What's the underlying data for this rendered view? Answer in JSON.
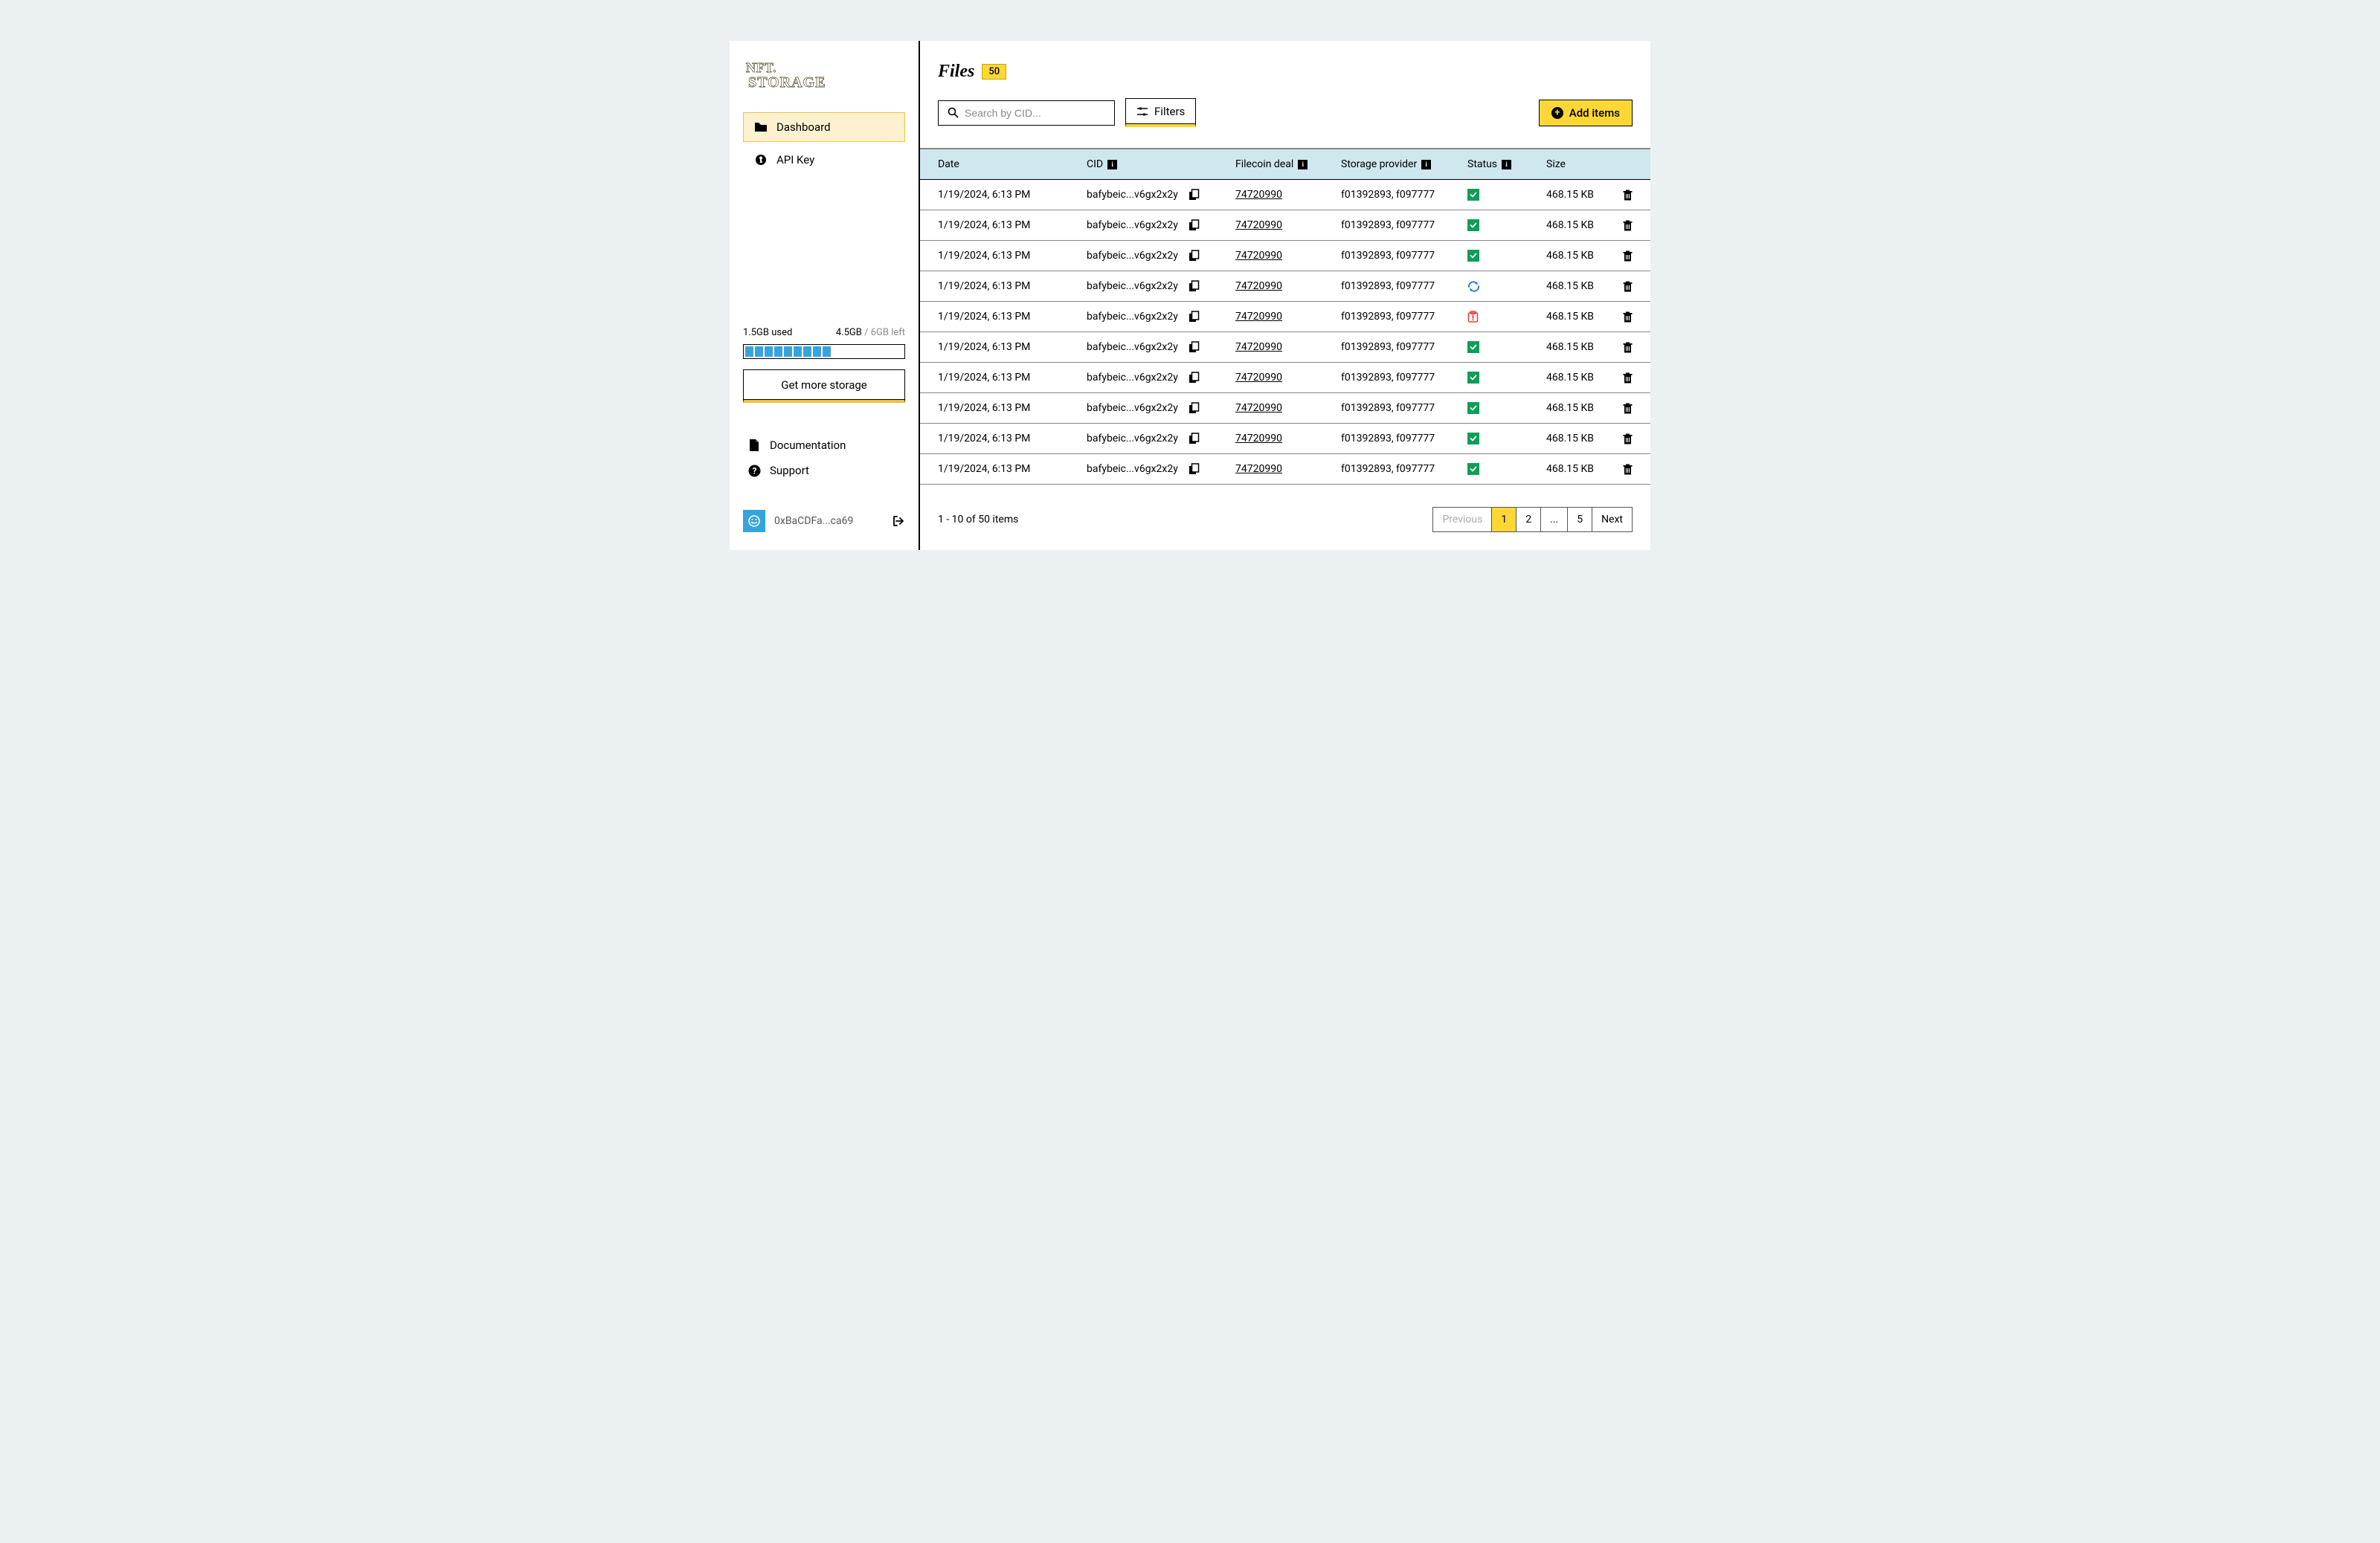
{
  "sidebar": {
    "nav": [
      {
        "label": "Dashboard",
        "icon": "folder",
        "active": true
      },
      {
        "label": "API Key",
        "icon": "key",
        "active": false
      }
    ],
    "storage": {
      "used": "1.5GB used",
      "avail": "4.5GB",
      "total_suffix": " / 6GB left",
      "segments": 9,
      "button": "Get more storage"
    },
    "util": [
      {
        "label": "Documentation",
        "icon": "doc"
      },
      {
        "label": "Support",
        "icon": "help"
      }
    ],
    "wallet": "0xBaCDFa...ca69"
  },
  "header": {
    "title": "Files",
    "count": "50",
    "search_placeholder": "Search by CID...",
    "filters": "Filters",
    "add": "Add items"
  },
  "columns": {
    "date": "Date",
    "cid": "CID",
    "deal": "Filecoin deal",
    "provider": "Storage provider",
    "status": "Status",
    "size": "Size"
  },
  "rows": [
    {
      "date": "1/19/2024, 6:13 PM",
      "cid": "bafybeic...v6gx2x2y",
      "deal": "74720990",
      "provider": "f01392893, f097777",
      "status": "ok",
      "size": "468.15 KB"
    },
    {
      "date": "1/19/2024, 6:13 PM",
      "cid": "bafybeic...v6gx2x2y",
      "deal": "74720990",
      "provider": "f01392893, f097777",
      "status": "ok",
      "size": "468.15 KB"
    },
    {
      "date": "1/19/2024, 6:13 PM",
      "cid": "bafybeic...v6gx2x2y",
      "deal": "74720990",
      "provider": "f01392893, f097777",
      "status": "ok",
      "size": "468.15 KB"
    },
    {
      "date": "1/19/2024, 6:13 PM",
      "cid": "bafybeic...v6gx2x2y",
      "deal": "74720990",
      "provider": "f01392893, f097777",
      "status": "sync",
      "size": "468.15 KB"
    },
    {
      "date": "1/19/2024, 6:13 PM",
      "cid": "bafybeic...v6gx2x2y",
      "deal": "74720990",
      "provider": "f01392893, f097777",
      "status": "err",
      "size": "468.15 KB"
    },
    {
      "date": "1/19/2024, 6:13 PM",
      "cid": "bafybeic...v6gx2x2y",
      "deal": "74720990",
      "provider": "f01392893, f097777",
      "status": "ok",
      "size": "468.15 KB"
    },
    {
      "date": "1/19/2024, 6:13 PM",
      "cid": "bafybeic...v6gx2x2y",
      "deal": "74720990",
      "provider": "f01392893, f097777",
      "status": "ok",
      "size": "468.15 KB"
    },
    {
      "date": "1/19/2024, 6:13 PM",
      "cid": "bafybeic...v6gx2x2y",
      "deal": "74720990",
      "provider": "f01392893, f097777",
      "status": "ok",
      "size": "468.15 KB"
    },
    {
      "date": "1/19/2024, 6:13 PM",
      "cid": "bafybeic...v6gx2x2y",
      "deal": "74720990",
      "provider": "f01392893, f097777",
      "status": "ok",
      "size": "468.15 KB"
    },
    {
      "date": "1/19/2024, 6:13 PM",
      "cid": "bafybeic...v6gx2x2y",
      "deal": "74720990",
      "provider": "f01392893, f097777",
      "status": "ok",
      "size": "468.15 KB"
    }
  ],
  "footer": {
    "range": "1 - 10 of 50 items",
    "pages": [
      {
        "label": "Previous",
        "state": "disabled"
      },
      {
        "label": "1",
        "state": "active"
      },
      {
        "label": "2",
        "state": ""
      },
      {
        "label": "...",
        "state": ""
      },
      {
        "label": "5",
        "state": ""
      },
      {
        "label": "Next",
        "state": ""
      }
    ]
  }
}
